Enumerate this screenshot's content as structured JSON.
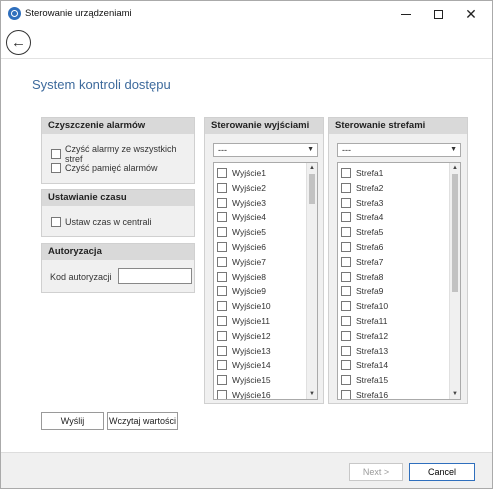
{
  "window": {
    "title": "Sterowanie urządzeniami",
    "icons": [
      "app-icon",
      "minimize-icon",
      "maximize-icon",
      "close-icon",
      "back-arrow-icon"
    ]
  },
  "page": {
    "title": "System kontroli dostępu"
  },
  "alarms": {
    "header": "Czyszczenie alarmów",
    "clear_all_label": "Czyść alarmy ze wszystkich stref",
    "clear_memory_label": "Czyść pamięć alarmów"
  },
  "time": {
    "header": "Ustawianie czasu",
    "set_time_label": "Ustaw czas w centrali"
  },
  "auth": {
    "header": "Autoryzacja",
    "code_label": "Kod autoryzacji",
    "code_value": ""
  },
  "outputs": {
    "header": "Sterowanie wyjściami",
    "selected": "---",
    "items": [
      "Wyjście1",
      "Wyjście2",
      "Wyjście3",
      "Wyjście4",
      "Wyjście5",
      "Wyjście6",
      "Wyjście7",
      "Wyjście8",
      "Wyjście9",
      "Wyjście10",
      "Wyjście11",
      "Wyjście12",
      "Wyjście13",
      "Wyjście14",
      "Wyjście15",
      "Wyjście16"
    ]
  },
  "zones": {
    "header": "Sterowanie strefami",
    "selected": "---",
    "items": [
      "Strefa1",
      "Strefa2",
      "Strefa3",
      "Strefa4",
      "Strefa5",
      "Strefa6",
      "Strefa7",
      "Strefa8",
      "Strefa9",
      "Strefa10",
      "Strefa11",
      "Strefa12",
      "Strefa13",
      "Strefa14",
      "Strefa15",
      "Strefa16"
    ]
  },
  "actions": {
    "send_label": "Wyślij",
    "load_label": "Wczytaj wartości"
  },
  "footer": {
    "next_label": "Next >",
    "cancel_label": "Cancel"
  }
}
